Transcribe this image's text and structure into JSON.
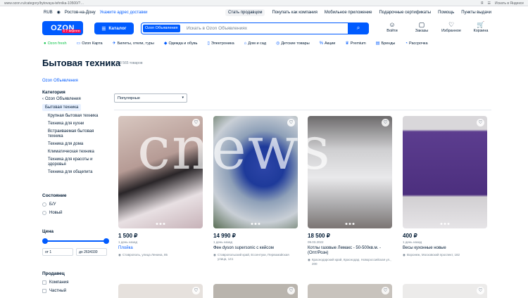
{
  "browser": {
    "url": "www.ozon.ru/category/bytovaya-tehnika-10500/?…",
    "right_text": "Я",
    "right_icon": "☰",
    "right_caption": "Искать в Яндексе"
  },
  "topstrip": {
    "region": "RUB",
    "city": "Ростов-на-Дону",
    "address_link": "Укажите адрес доставки",
    "links": [
      "Стать продавцом",
      "Покупать как компания",
      "Мобильное приложение",
      "Подарочные сертификаты",
      "Помощь",
      "Пункты выдачи"
    ]
  },
  "header": {
    "logo": "OZON",
    "logo_sub": "с 7 апреля",
    "catalog": "Каталог",
    "search_chip": "Ozon Объявления",
    "search_placeholder": "Искать в Ozon Объявлениях",
    "actions": [
      {
        "label": "Войти",
        "icon": "☺"
      },
      {
        "label": "Заказы",
        "icon": "▢"
      },
      {
        "label": "Избранное",
        "icon": "♡"
      },
      {
        "label": "Корзина",
        "icon": "🛒"
      }
    ]
  },
  "nav": [
    {
      "label": "Ozon fresh",
      "icon": "●"
    },
    {
      "label": "Ozon Карта",
      "icon": "▭"
    },
    {
      "label": "Билеты, отели, туры",
      "icon": "✈"
    },
    {
      "label": "Одежда и обувь",
      "icon": "◆"
    },
    {
      "label": "Электроника",
      "icon": "▯"
    },
    {
      "label": "Дом и сад",
      "icon": "⌂"
    },
    {
      "label": "Детские товары",
      "icon": "◎"
    },
    {
      "label": "Акции",
      "icon": "%"
    },
    {
      "label": "Premium",
      "icon": "♛"
    },
    {
      "label": "Бренды",
      "icon": "▤"
    },
    {
      "label": "Рассрочка",
      "icon": "◔"
    }
  ],
  "page": {
    "title": "Бытовая техника",
    "count": "8 565 товаров",
    "breadcrumb": "Ozon Объявления"
  },
  "sidebar": {
    "category_title": "Категория",
    "back": "Ozon Объявления",
    "current": "Бытовая техника",
    "items": [
      "Крупная бытовая техника",
      "Техника для кухни",
      "Встраиваемая бытовая техника",
      "Техника для дома",
      "Климатическая техника",
      "Техника для красоты и здоровья",
      "Техника для общепита"
    ]
  },
  "filters": {
    "condition_title": "Состояние",
    "condition": [
      "Б/У",
      "Новый"
    ],
    "price_title": "Цена",
    "price_min": "от 1",
    "price_max": "до 2634330",
    "seller_title": "Продавец",
    "seller": [
      "Компания",
      "Частный"
    ]
  },
  "sort": {
    "label": "Популярные",
    "icon": "▾"
  },
  "products": [
    {
      "price": "1 500 ₽",
      "date": "1 день назад",
      "name": "Плойка",
      "location": "Ставрополь, улица Ленина, 85",
      "link": true
    },
    {
      "price": "14 990 ₽",
      "date": "1 день назад",
      "name": "Фен dyson supersonic с кейсом",
      "location": "Ставропольский край, Ессентуки, Первомайская улица, 141",
      "link": false
    },
    {
      "price": "18 500 ₽",
      "date": "09.03.2022",
      "name": "Котлы газовые Лемакс - 50-500кв.м. - (Опт/Розн)",
      "location": "Краснодарский край, Краснодар, Новороссийская ул., 200",
      "link": false
    },
    {
      "price": "400 ₽",
      "date": "1 день назад",
      "name": "Весы кухонные новые",
      "location": "Воронеж, Московский проспект, 182",
      "link": false
    }
  ],
  "watermark": "cnews",
  "icons": {
    "heart": "♡",
    "pin": "◉",
    "search": "⌕",
    "back": "‹"
  },
  "colors": {
    "accent": "#005bff",
    "fresh": "#10c44c",
    "promo": "#f91155"
  }
}
